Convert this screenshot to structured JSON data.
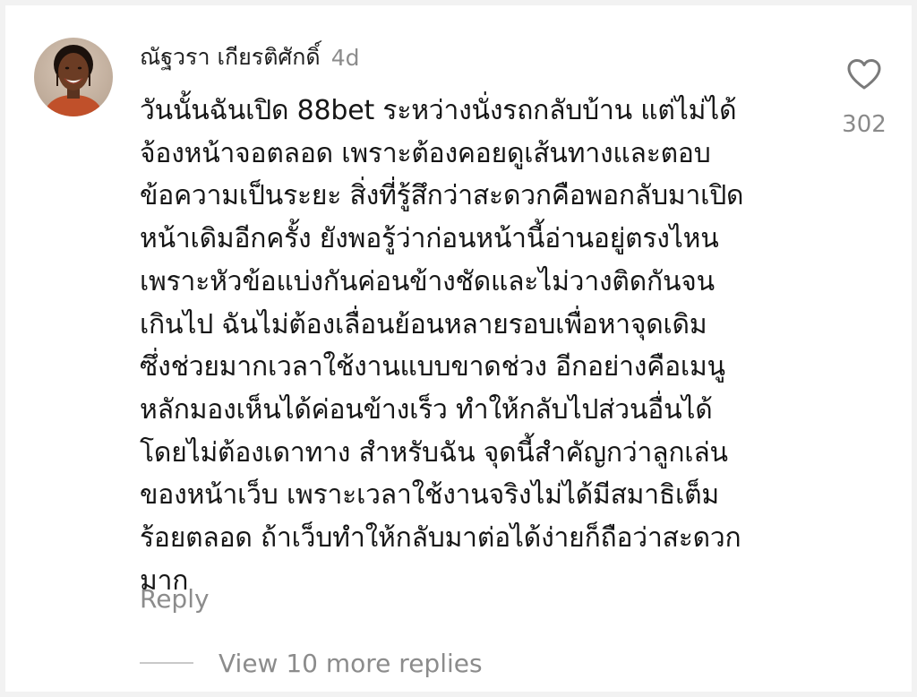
{
  "comment": {
    "author": "ณัฐวรา เกียรติศักดิ์",
    "time_ago": "4d",
    "avatar": {
      "icon": "user-avatar-photo"
    },
    "body_lines": [
      "วันนั้นฉันเปิด 88bet ระหว่างนั่งรถกลับบ้าน แต่ไม่ได้",
      "จ้องหน้าจอตลอด เพราะต้องคอยดูเส้นทางและตอบ",
      "ข้อความเป็นระยะ สิ่งที่รู้สึกว่าสะดวกคือพอกลับมาเปิด",
      "หน้าเดิมอีกครั้ง ยังพอรู้ว่าก่อนหน้านี้อ่านอยู่ตรงไหน",
      "เพราะหัวข้อแบ่งกันค่อนข้างชัดและไม่วางติดกันจน",
      "เกินไป ฉันไม่ต้องเลื่อนย้อนหลายรอบเพื่อหาจุดเดิม",
      "ซึ่งช่วยมากเวลาใช้งานแบบขาดช่วง อีกอย่างคือเมนู",
      "หลักมองเห็นได้ค่อนข้างเร็ว ทำให้กลับไปส่วนอื่นได้",
      "โดยไม่ต้องเดาทาง สำหรับฉัน จุดนี้สำคัญกว่าลูกเล่น",
      "ของหน้าเว็บ เพราะเวลาใช้งานจริงไม่ได้มีสมาธิเต็ม",
      "ร้อยตลอด ถ้าเว็บทำให้กลับมาต่อได้ง่ายก็ถือว่าสะดวก",
      "มาก"
    ],
    "like": {
      "icon": "heart-outline-icon",
      "count": "302"
    },
    "reply_label": "Reply",
    "view_more_label": "View 10 more replies"
  },
  "colors": {
    "background": "#f2f2f2",
    "card": "#ffffff",
    "text_primary": "#161616",
    "text_secondary": "#8c8c8c",
    "icon_stroke": "#7a7a7a"
  }
}
